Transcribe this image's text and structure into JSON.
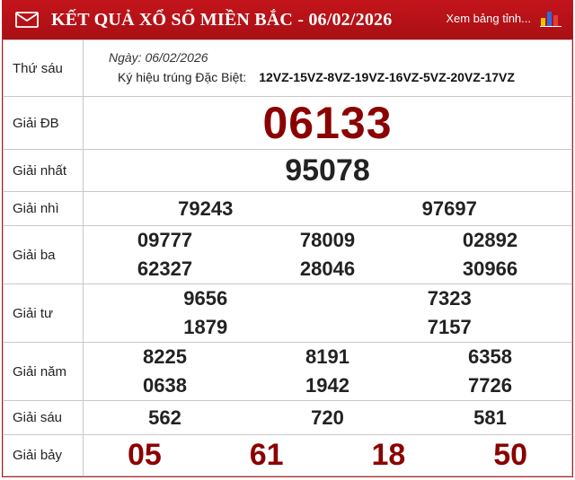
{
  "header": {
    "title": "KẾT QUẢ XỔ SỐ MIỀN BẮC - 06/02/2026",
    "link": "Xem bảng tỉnh...",
    "mail_icon": "envelope-icon",
    "chart_icon": "bar-chart-icon",
    "accent": "#b91c1c"
  },
  "meta": {
    "day": "Thứ sáu",
    "date_label": "Ngày: 06/02/2026",
    "kyhieu_label": "Ký hiệu trúng Đặc Biệt:",
    "kyhieu_value": "12VZ-15VZ-8VZ-19VZ-16VZ-5VZ-20VZ-17VZ"
  },
  "prizes": {
    "db": {
      "label": "Giải ĐB",
      "values": [
        "06133"
      ]
    },
    "nhat": {
      "label": "Giải nhất",
      "values": [
        "95078"
      ]
    },
    "nhi": {
      "label": "Giải nhì",
      "values": [
        "79243",
        "97697"
      ]
    },
    "ba": {
      "label": "Giải ba",
      "values": [
        "09777",
        "78009",
        "02892",
        "62327",
        "28046",
        "30966"
      ]
    },
    "tu": {
      "label": "Giải tư",
      "values": [
        "9656",
        "7323",
        "1879",
        "7157"
      ]
    },
    "nam": {
      "label": "Giải năm",
      "values": [
        "8225",
        "8191",
        "6358",
        "0638",
        "1942",
        "7726"
      ]
    },
    "sau": {
      "label": "Giải sáu",
      "values": [
        "562",
        "720",
        "581"
      ]
    },
    "bay": {
      "label": "Giải bảy",
      "values": [
        "05",
        "61",
        "18",
        "50"
      ]
    }
  }
}
